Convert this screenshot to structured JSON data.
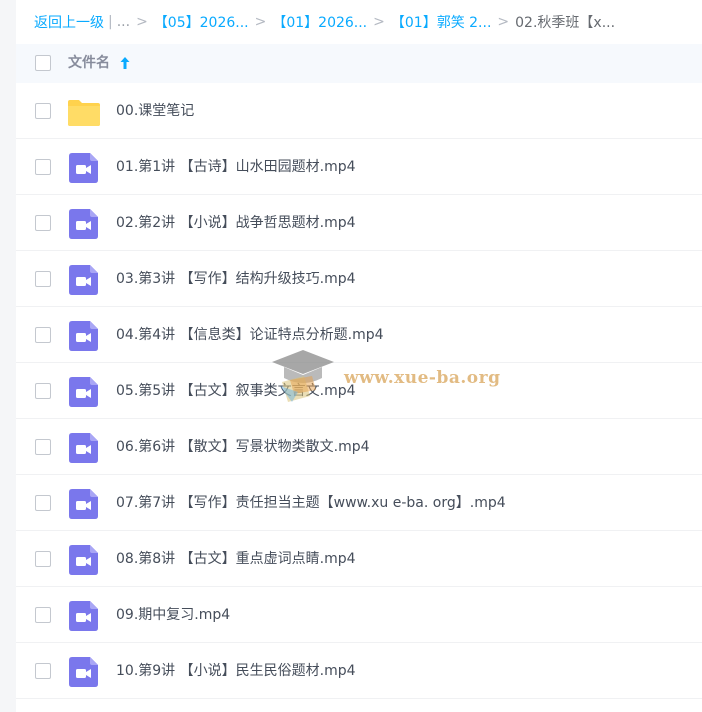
{
  "breadcrumb": {
    "back_label": "返回上一级",
    "divider": "|",
    "ellipsis": "...",
    "separator": ">",
    "items": [
      {
        "label": "【05】2026..."
      },
      {
        "label": "【01】2026..."
      },
      {
        "label": "【01】郭笑 2..."
      }
    ],
    "current": "02.秋季班【x..."
  },
  "header": {
    "column_label": "文件名",
    "sort_direction": "ascending",
    "sort_icon": "arrow-up-icon"
  },
  "files": [
    {
      "name": "00.课堂笔记",
      "type": "folder",
      "icon": "folder-icon"
    },
    {
      "name": "01.第1讲 【古诗】山水田园题材.mp4",
      "type": "video",
      "icon": "video-file-icon"
    },
    {
      "name": "02.第2讲 【小说】战争哲思题材.mp4",
      "type": "video",
      "icon": "video-file-icon"
    },
    {
      "name": "03.第3讲 【写作】结构升级技巧.mp4",
      "type": "video",
      "icon": "video-file-icon"
    },
    {
      "name": "04.第4讲 【信息类】论证特点分析题.mp4",
      "type": "video",
      "icon": "video-file-icon"
    },
    {
      "name": "05.第5讲 【古文】叙事类文言文.mp4",
      "type": "video",
      "icon": "video-file-icon"
    },
    {
      "name": "06.第6讲 【散文】写景状物类散文.mp4",
      "type": "video",
      "icon": "video-file-icon"
    },
    {
      "name": "07.第7讲 【写作】责任担当主题【www.xu e-ba. org】.mp4",
      "type": "video",
      "icon": "video-file-icon"
    },
    {
      "name": "08.第8讲 【古文】重点虚词点睛.mp4",
      "type": "video",
      "icon": "video-file-icon"
    },
    {
      "name": "09.期中复习.mp4",
      "type": "video",
      "icon": "video-file-icon"
    },
    {
      "name": "10.第9讲 【小说】民生民俗题材.mp4",
      "type": "video",
      "icon": "video-file-icon"
    }
  ],
  "watermark": {
    "text": "www.xue-ba.org",
    "icon": "graduation-cap-icon"
  },
  "colors": {
    "link": "#09aaff",
    "header_bg": "#f6f9fd",
    "text": "#454d5a",
    "folder": "#ffd24d",
    "video_icon": "#7a77ec",
    "watermark": "#d9a55a"
  }
}
